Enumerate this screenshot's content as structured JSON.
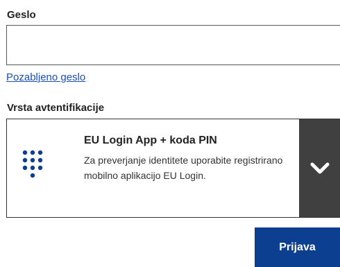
{
  "password": {
    "label": "Geslo",
    "value": "",
    "placeholder": "",
    "forgot_link": "Pozabljeno geslo"
  },
  "auth": {
    "label": "Vrsta avtentifikacije",
    "selected": {
      "icon": "keypad-icon",
      "title": "EU Login App + koda PIN",
      "description": "Za preverjanje identitete uporabite registrirano mobilno aplikacijo EU Login."
    },
    "toggle_icon": "chevron-down-icon"
  },
  "submit": {
    "label": "Prijava"
  },
  "colors": {
    "link": "#1a4fbd",
    "toggle_bg": "#404040",
    "button_bg": "#0d3f91",
    "keypad_dots": "#0d3f91"
  }
}
